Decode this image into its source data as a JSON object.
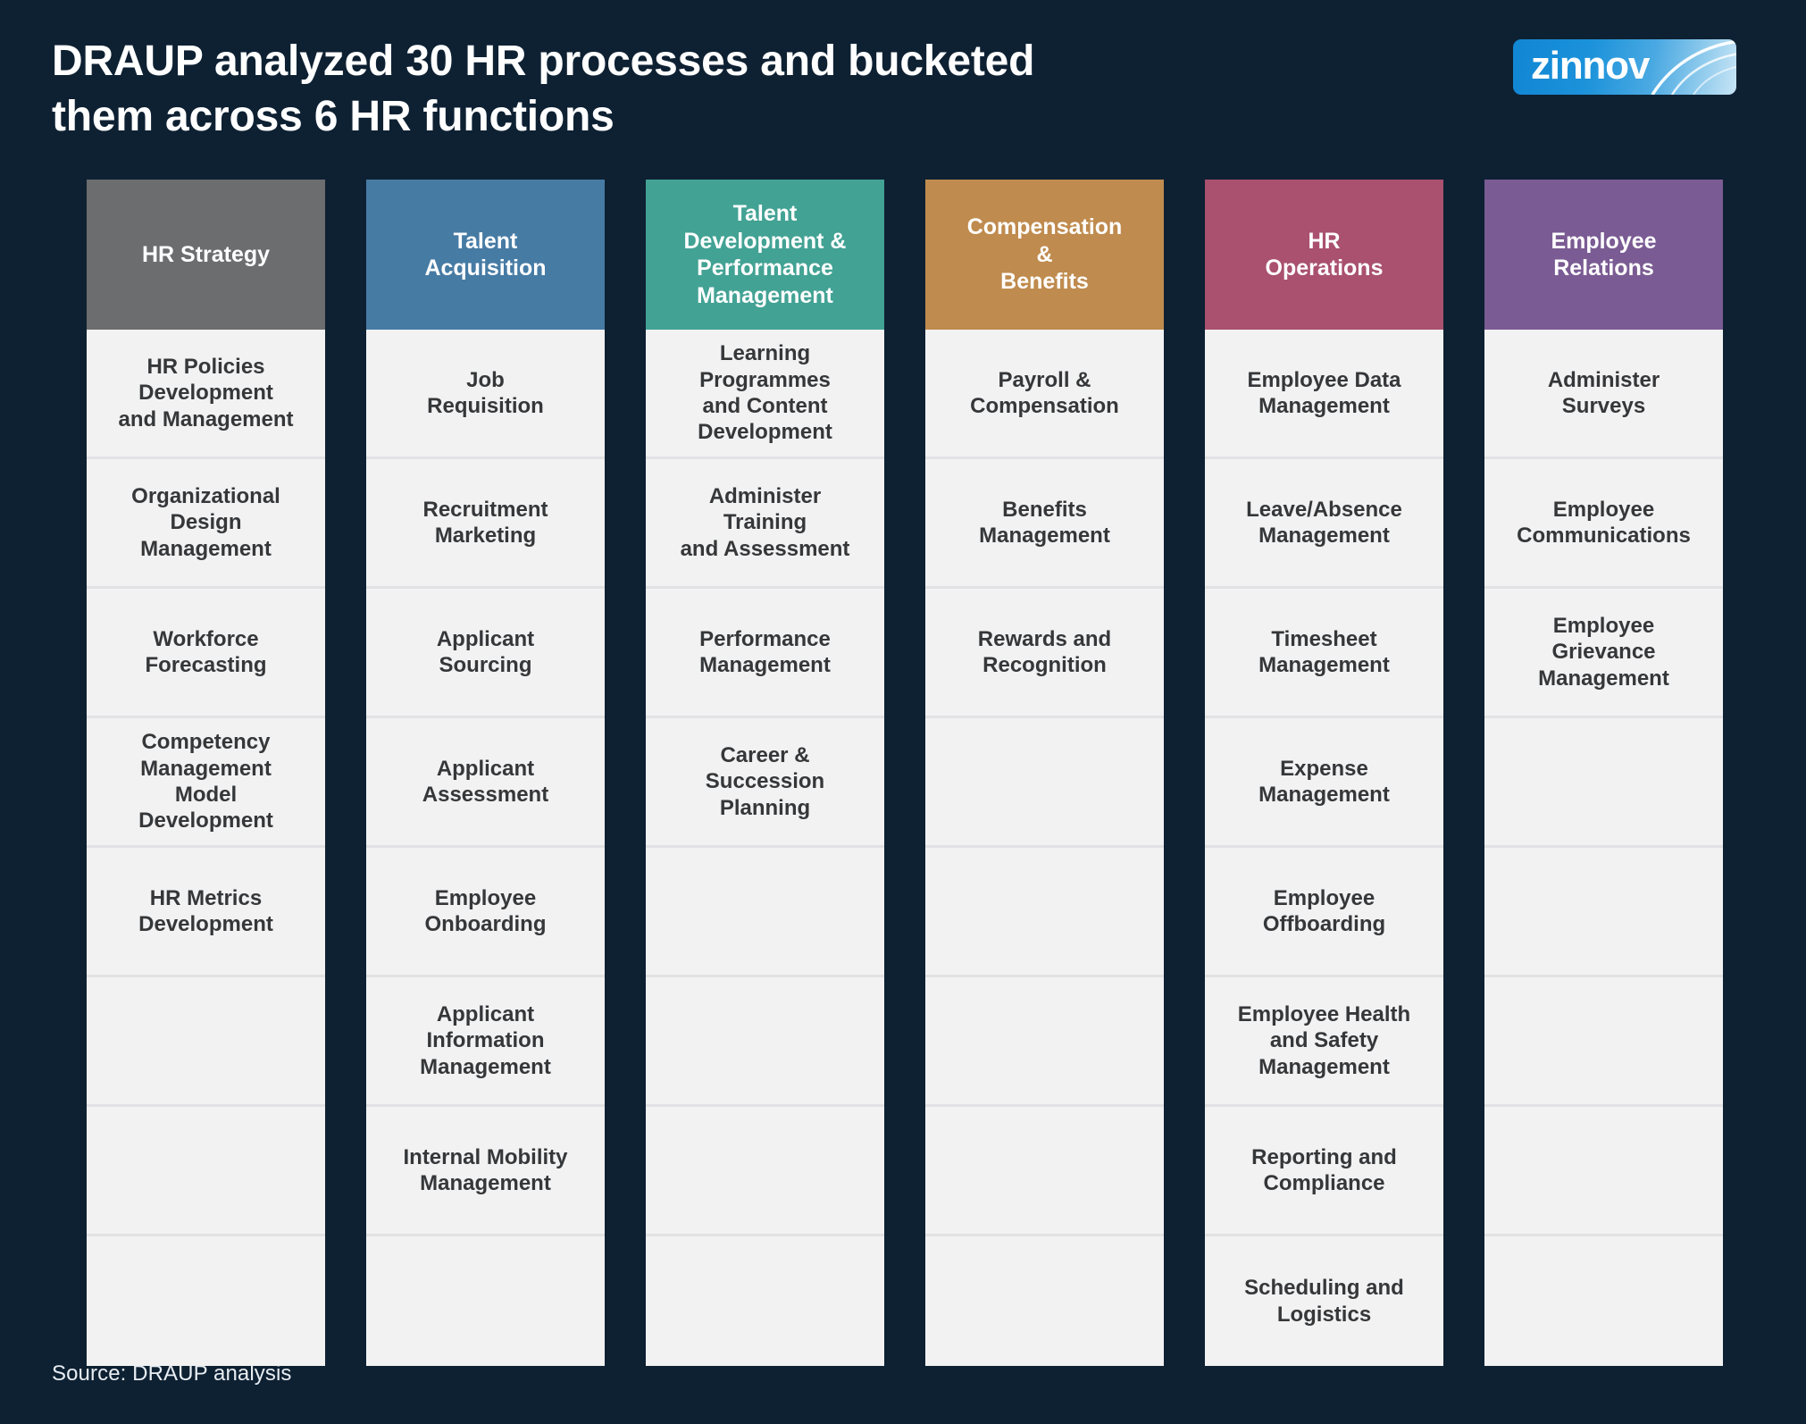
{
  "page": {
    "background_color": "#0e2133",
    "title_line_1": "DRAUP analyzed 30 HR processes and bucketed",
    "title_line_2": "them across 6 HR functions",
    "title_full": "DRAUP analyzed 30 HR processes and bucketed them across 6 HR functions",
    "source_note": "Source: DRAUP analysis"
  },
  "logo": {
    "text": "zinnov",
    "accent_color": "#1186d4"
  },
  "chart_data": {
    "type": "table",
    "title": "DRAUP analyzed 30 HR processes and bucketed them across 6 HR functions",
    "columns_count": 6,
    "rows_per_column": 8,
    "total_processes": 30,
    "categories": [
      "HR Strategy",
      "Talent Acquisition",
      "Talent Development & Performance Management",
      "Compensation & Benefits",
      "HR Operations",
      "Employee Relations"
    ],
    "values": [
      5,
      7,
      4,
      3,
      8,
      3
    ]
  },
  "columns": [
    {
      "header": "HR Strategy",
      "header_color": "#6c6d6f",
      "items": [
        "HR Policies\nDevelopment\nand Management",
        "Organizational\nDesign\nManagement",
        "Workforce\nForecasting",
        "Competency\nManagement\nModel\nDevelopment",
        "HR Metrics\nDevelopment",
        "",
        "",
        ""
      ]
    },
    {
      "header": "Talent\nAcquisition",
      "header_color": "#467ba4",
      "items": [
        "Job\nRequisition",
        "Recruitment\nMarketing",
        "Applicant\nSourcing",
        "Applicant\nAssessment",
        "Employee\nOnboarding",
        "Applicant\nInformation\nManagement",
        "Internal Mobility\nManagement",
        ""
      ]
    },
    {
      "header": "Talent\nDevelopment &\nPerformance\nManagement",
      "header_color": "#42a294",
      "items": [
        "Learning\nProgrammes\nand Content\nDevelopment",
        "Administer\nTraining\nand Assessment",
        "Performance\nManagement",
        "Career &\nSuccession\nPlanning",
        "",
        "",
        "",
        ""
      ]
    },
    {
      "header": "Compensation\n&\nBenefits",
      "header_color": "#bf8b4e",
      "items": [
        "Payroll &\nCompensation",
        "Benefits\nManagement",
        "Rewards and\nRecognition",
        "",
        "",
        "",
        "",
        ""
      ]
    },
    {
      "header": "HR\nOperations",
      "header_color": "#a9516e",
      "items": [
        "Employee Data\nManagement",
        "Leave/Absence\nManagement",
        "Timesheet\nManagement",
        "Expense\nManagement",
        "Employee\nOffboarding",
        "Employee Health\nand Safety\nManagement",
        "Reporting and\nCompliance",
        "Scheduling and\nLogistics"
      ]
    },
    {
      "header": "Employee\nRelations",
      "header_color": "#7a5b93",
      "items": [
        "Administer\nSurveys",
        "Employee\nCommunications",
        "Employee\nGrievance\nManagement",
        "",
        "",
        "",
        "",
        ""
      ]
    }
  ]
}
